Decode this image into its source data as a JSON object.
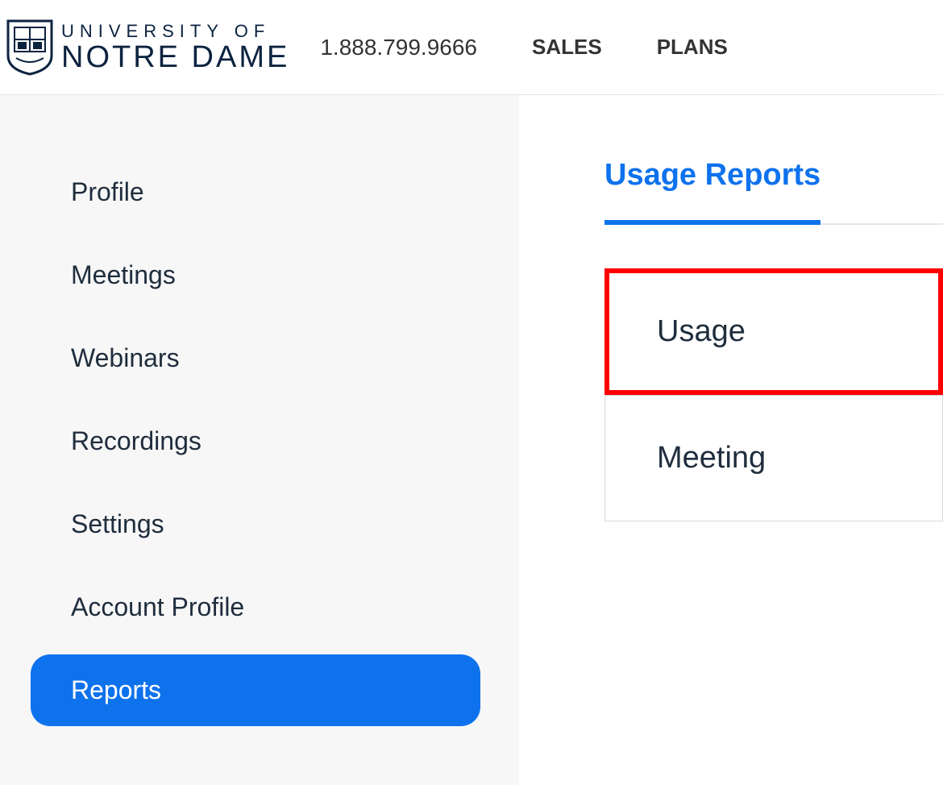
{
  "header": {
    "logo": {
      "line1": "UNIVERSITY OF",
      "line2": "NOTRE DAME"
    },
    "phone": "1.888.799.9666",
    "nav": [
      {
        "label": "SALES"
      },
      {
        "label": "PLANS"
      }
    ]
  },
  "sidebar": {
    "items": [
      {
        "label": "Profile",
        "active": false
      },
      {
        "label": "Meetings",
        "active": false
      },
      {
        "label": "Webinars",
        "active": false
      },
      {
        "label": "Recordings",
        "active": false
      },
      {
        "label": "Settings",
        "active": false
      },
      {
        "label": "Account Profile",
        "active": false
      },
      {
        "label": "Reports",
        "active": true
      }
    ]
  },
  "main": {
    "tab_title": "Usage Reports",
    "cards": [
      {
        "label": "Usage",
        "highlighted": true
      },
      {
        "label": "Meeting",
        "highlighted": false
      }
    ]
  }
}
